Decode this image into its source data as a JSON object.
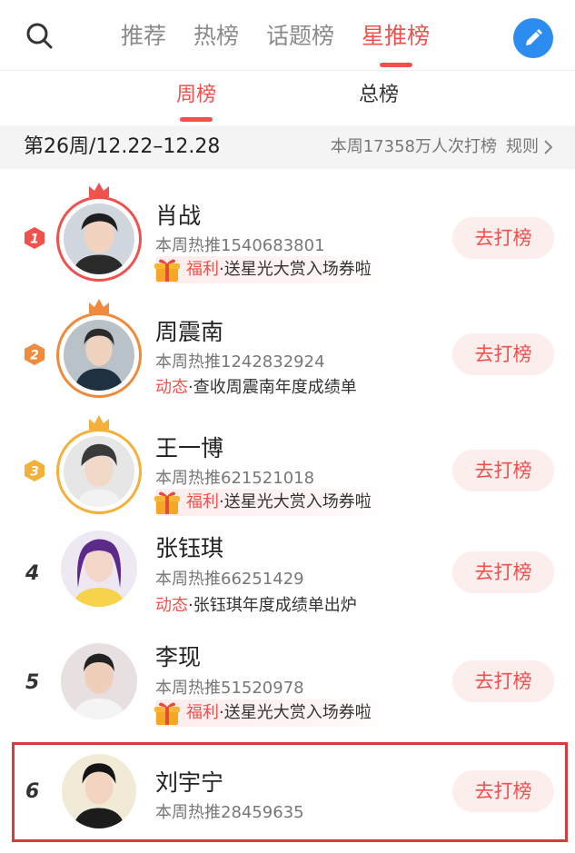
{
  "nav": {
    "tabs": [
      {
        "label": "推荐",
        "active": false
      },
      {
        "label": "热榜",
        "active": false
      },
      {
        "label": "话题榜",
        "active": false
      },
      {
        "label": "星推榜",
        "active": true
      }
    ],
    "search_icon": "search-icon",
    "edit_icon": "pencil-icon"
  },
  "subtabs": [
    {
      "label": "周榜",
      "active": true
    },
    {
      "label": "总榜",
      "active": false
    }
  ],
  "week": {
    "title": "第26周/12.22–12.28",
    "summary": "本周17358万人次打榜",
    "rules_label": "规则",
    "rules_icon": "chevron-right-icon"
  },
  "action_label": "去打榜",
  "stars": [
    {
      "rank": "1",
      "name": "肖战",
      "hot": "本周热推1540683801",
      "extra_tag": "福利",
      "extra_text": "·送星光大赏入场券啦",
      "extra_type": "welfare"
    },
    {
      "rank": "2",
      "name": "周震南",
      "hot": "本周热推1242832924",
      "extra_tag": "动态",
      "extra_text": "·查收周震南年度成绩单",
      "extra_type": "news"
    },
    {
      "rank": "3",
      "name": "王一博",
      "hot": "本周热推621521018",
      "extra_tag": "福利",
      "extra_text": "·送星光大赏入场券啦",
      "extra_type": "welfare"
    },
    {
      "rank": "4",
      "name": "张钰琪",
      "hot": "本周热推66251429",
      "extra_tag": "动态",
      "extra_text": "·张钰琪年度成绩单出炉",
      "extra_type": "news"
    },
    {
      "rank": "5",
      "name": "李现",
      "hot": "本周热推51520978",
      "extra_tag": "福利",
      "extra_text": "·送星光大赏入场券啦",
      "extra_type": "welfare"
    },
    {
      "rank": "6",
      "name": "刘宇宁",
      "hot": "本周热推28459635",
      "extra_tag": "",
      "extra_text": "",
      "extra_type": ""
    }
  ],
  "colors": {
    "accent": "#f0514d",
    "rank1": "#f0514d",
    "rank2": "#f08a3c",
    "rank3": "#f4b03a",
    "edit_button": "#2d8cf0"
  }
}
